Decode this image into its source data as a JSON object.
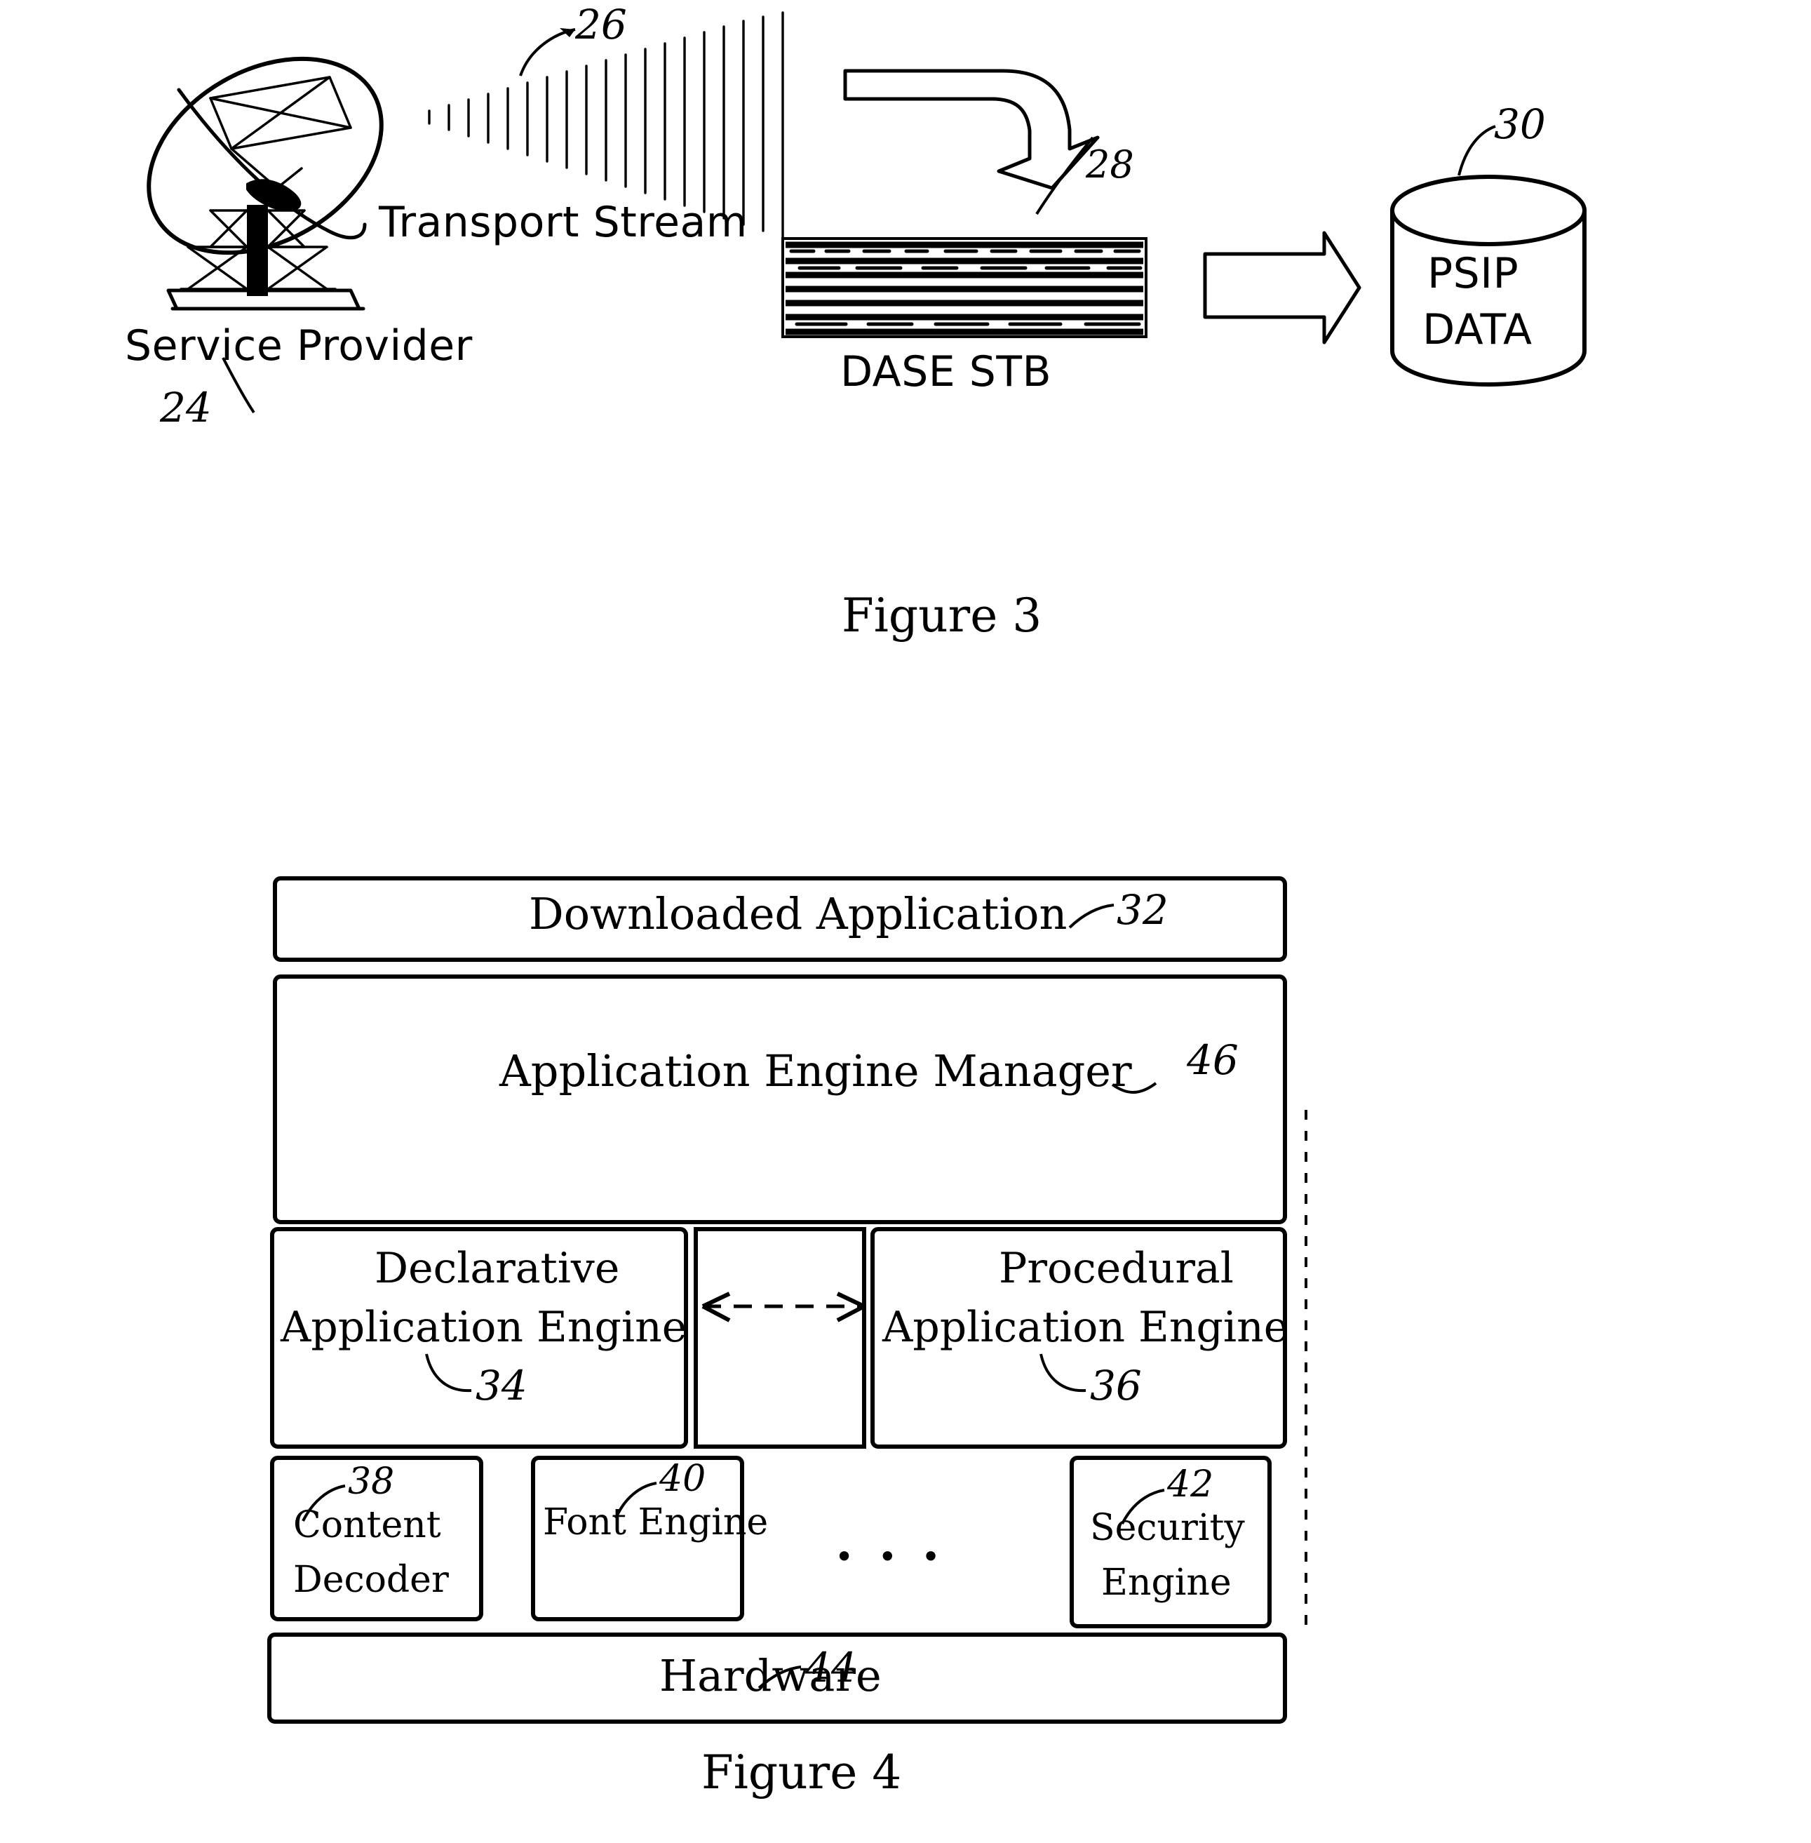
{
  "document": {
    "type": "patent-drawing-sheet",
    "figures": [
      "Figure 3",
      "Figure 4"
    ]
  },
  "figure3": {
    "caption": "Figure 3",
    "labels": {
      "service_provider": "Service Provider",
      "transport_stream": "Transport Stream",
      "dase_stb": "DASE STB",
      "psip_line1": "PSIP",
      "psip_line2": "DATA"
    },
    "reference_numerals": {
      "service_provider": "24",
      "transport_stream": "26",
      "dase_stb": "28",
      "psip_data": "30"
    },
    "elements": [
      {
        "name": "satellite-dish",
        "label": "Service Provider",
        "ref": "24"
      },
      {
        "name": "signal-beam",
        "label": "Transport Stream",
        "ref": "26"
      },
      {
        "name": "set-top-box",
        "label": "DASE STB",
        "ref": "28"
      },
      {
        "name": "database-cylinder",
        "label": "PSIP DATA",
        "ref": "30"
      }
    ],
    "arrows": [
      {
        "name": "stream-to-stb-arrow",
        "style": "hollow-block-curved",
        "direction": "down-right"
      },
      {
        "name": "stb-to-psip-arrow",
        "style": "hollow-block-straight",
        "direction": "right"
      }
    ]
  },
  "figure4": {
    "caption": "Figure 4",
    "blocks": [
      {
        "name": "downloaded-application",
        "label": "Downloaded Application",
        "ref": "32"
      },
      {
        "name": "application-engine-manager",
        "label": "Application Engine Manager",
        "ref": "46"
      },
      {
        "name": "declarative-application-engine",
        "label_line1": "Declarative",
        "label_line2": "Application Engine",
        "ref": "34"
      },
      {
        "name": "procedural-application-engine",
        "label_line1": "Procedural",
        "label_line2": "Application Engine",
        "ref": "36"
      },
      {
        "name": "content-decoder",
        "label_line1": "Content",
        "label_line2": "Decoder",
        "ref": "38"
      },
      {
        "name": "font-engine",
        "label_line1": "Font Engine",
        "label_line2": "",
        "ref": "40"
      },
      {
        "name": "security-engine",
        "label_line1": "Security",
        "label_line2": "Engine",
        "ref": "42"
      },
      {
        "name": "hardware",
        "label": "Hardware",
        "ref": "44"
      }
    ],
    "ellipsis": "• • •",
    "connector": {
      "name": "engine-interop-arrow",
      "style": "dashed-bidirectional",
      "from": "declarative-application-engine",
      "to": "procedural-application-engine"
    }
  },
  "colors": {
    "ink": "#000000",
    "paper": "#ffffff"
  }
}
